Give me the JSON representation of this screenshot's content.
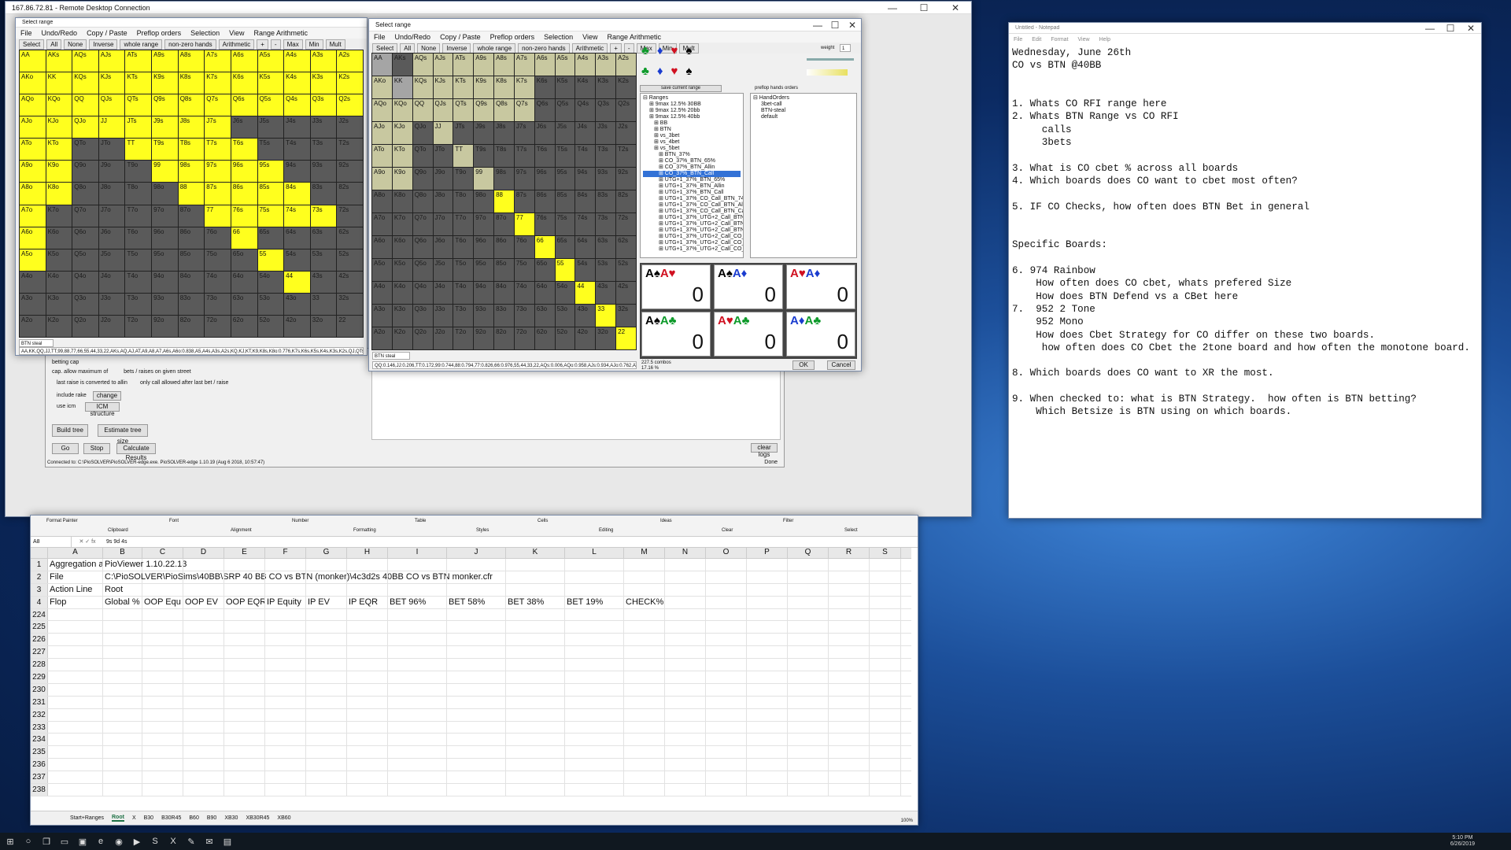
{
  "rdp": {
    "title": "167.86.72.81 - Remote Desktop Connection",
    "min": "—",
    "max": "☐",
    "close": "✕"
  },
  "ranges": [
    "AA",
    "AKs",
    "AQs",
    "AJs",
    "ATs",
    "A9s",
    "A8s",
    "A7s",
    "A6s",
    "A5s",
    "A4s",
    "A3s",
    "A2s",
    "AKo",
    "KK",
    "KQs",
    "KJs",
    "KTs",
    "K9s",
    "K8s",
    "K7s",
    "K6s",
    "K5s",
    "K4s",
    "K3s",
    "K2s",
    "AQo",
    "KQo",
    "QQ",
    "QJs",
    "QTs",
    "Q9s",
    "Q8s",
    "Q7s",
    "Q6s",
    "Q5s",
    "Q4s",
    "Q3s",
    "Q2s",
    "AJo",
    "KJo",
    "QJo",
    "JJ",
    "JTs",
    "J9s",
    "J8s",
    "J7s",
    "J6s",
    "J5s",
    "J4s",
    "J3s",
    "J2s",
    "ATo",
    "KTo",
    "QTo",
    "JTo",
    "TT",
    "T9s",
    "T8s",
    "T7s",
    "T6s",
    "T5s",
    "T4s",
    "T3s",
    "T2s",
    "A9o",
    "K9o",
    "Q9o",
    "J9o",
    "T9o",
    "99",
    "98s",
    "97s",
    "96s",
    "95s",
    "94s",
    "93s",
    "92s",
    "A8o",
    "K8o",
    "Q8o",
    "J8o",
    "T8o",
    "98o",
    "88",
    "87s",
    "86s",
    "85s",
    "84s",
    "83s",
    "82s",
    "A7o",
    "K7o",
    "Q7o",
    "J7o",
    "T7o",
    "97o",
    "87o",
    "77",
    "76s",
    "75s",
    "74s",
    "73s",
    "72s",
    "A6o",
    "K6o",
    "Q6o",
    "J6o",
    "T6o",
    "96o",
    "86o",
    "76o",
    "66",
    "65s",
    "64s",
    "63s",
    "62s",
    "A5o",
    "K5o",
    "Q5o",
    "J5o",
    "T5o",
    "95o",
    "85o",
    "75o",
    "65o",
    "55",
    "54s",
    "53s",
    "52s",
    "A4o",
    "K4o",
    "Q4o",
    "J4o",
    "T4o",
    "94o",
    "84o",
    "74o",
    "64o",
    "54o",
    "44",
    "43s",
    "42s",
    "A3o",
    "K3o",
    "Q3o",
    "J3o",
    "T3o",
    "93o",
    "83o",
    "73o",
    "63o",
    "53o",
    "43o",
    "33",
    "32s",
    "A2o",
    "K2o",
    "Q2o",
    "J2o",
    "T2o",
    "92o",
    "82o",
    "72o",
    "62o",
    "52o",
    "42o",
    "32o",
    "22"
  ],
  "w1": {
    "title": "Select range",
    "menu": [
      "File",
      "Undo/Redo",
      "Copy / Paste",
      "Preflop orders",
      "Selection",
      "View",
      "Range Arithmetic"
    ],
    "tools": [
      "Select",
      "All",
      "None",
      "Inverse",
      "whole range",
      "non-zero hands",
      "Arithmetic",
      "+",
      "-",
      "Max",
      "Min",
      "Mult"
    ],
    "status": "BTN steal",
    "range_text": "AA,KK,QQ,JJ,TT,99,88,77,66,55,44,33,22,AKs,AQ,AJ,AT,A9,A8,A7,A6s,A6o:0.838,A5,A4s,A3s,A2s,KQ,KJ,KT,K9,K8s,K8o:0.776,K7s,K6s,K5s,K4s,K3s,K2s,QJ,QTs,Q9s,Q8s,Q7s,Q6s"
  },
  "w2": {
    "title": "Select range",
    "menu": [
      "File",
      "Undo/Redo",
      "Copy / Paste",
      "Preflop orders",
      "Selection",
      "View",
      "Range Arithmetic"
    ],
    "tools": [
      "Select",
      "All",
      "None",
      "Inverse",
      "whole range",
      "non-zero hands",
      "Arithmetic",
      "+",
      "-",
      "Max",
      "Min",
      "Mult"
    ],
    "weight_label": "weight",
    "weight_value": "1",
    "save_label": "save current range",
    "preflop_label": "preflop hands orders",
    "tree": [
      "Ranges",
      "9max 12.5% 30BB",
      "9max 12.5% 20bb",
      "9max 12.5% 40bb",
      "BB",
      "BTN",
      "vs_3bet",
      "vs_4bet",
      "vs_5bet",
      "BTN_37%",
      "CO_37%_BTN_65%",
      "CO_37%_BTN_Allin",
      "CO_37%_BTN_Call",
      "UTG+1_37%_BTN_65%",
      "UTG+1_37%_BTN_Allin",
      "UTG+1_37%_BTN_Call",
      "UTG+1_37%_CO_Call_BTN_74%",
      "UTG+1_37%_CO_Call_BTN_Allin",
      "UTG+1_37%_CO_Call_BTN_Call",
      "UTG+1_37%_UTG+2_Call_BTN_74",
      "UTG+1_37%_UTG+2_Call_BTN_All",
      "UTG+1_37%_UTG+2_Call_BTN_Ca",
      "UTG+1_37%_UTG+2_Call_CO_Call",
      "UTG+1_37%_UTG+2_Call_CO_Call",
      "UTG+1_37%_UTG+2_Call_CO_Call"
    ],
    "tree_selected": "CO_37%_BTN_Call",
    "hand_orders": [
      "HandOrders",
      "3bet-call",
      "BTN-steal",
      "default"
    ],
    "combos": [
      {
        "a": "A♠",
        "b": "A♥",
        "ca": "blk",
        "cb": "red",
        "v": "0"
      },
      {
        "a": "A♠",
        "b": "A♦",
        "ca": "blk",
        "cb": "blu",
        "v": "0"
      },
      {
        "a": "A♥",
        "b": "A♦",
        "ca": "red",
        "cb": "blu",
        "v": "0"
      },
      {
        "a": "A♠",
        "b": "A♣",
        "ca": "blk",
        "cb": "grn",
        "v": "0"
      },
      {
        "a": "A♥",
        "b": "A♣",
        "ca": "red",
        "cb": "grn",
        "v": "0"
      },
      {
        "a": "A♦",
        "b": "A♣",
        "ca": "blu",
        "cb": "grn",
        "v": "0"
      }
    ],
    "combo_count": "227.5 combos",
    "combo_pct": "17.16 %",
    "ok": "OK",
    "cancel": "Cancel",
    "status": "BTN steal",
    "range_text": "QQ:0.146,JJ:0.206,TT:0.172,99:0.744,88:0.794,77:0.826,66:0.976,55,44,33,22,AQs:0.006,AQo:0.958,AJs:0.934,AJo:0.762,ATs:0.51,ATo:0.51"
  },
  "solver": {
    "betting_cap": "betting cap",
    "cap_label": "cap. allow maximum of",
    "cap_suffix": "bets / raises on given street",
    "last_raise": "last raise is converted to allin",
    "only_call": "only call allowed after last bet / raise",
    "include_rake": "include rake",
    "change": "change",
    "use_icm": "use icm",
    "icm_structure": "ICM structure",
    "build_tree": "Build tree",
    "estimate": "Estimate tree size",
    "go": "Go",
    "stop": "Stop",
    "calc": "Calculate Results",
    "clear_logs": "clear logs",
    "done": "Done",
    "connected": "Connected to: C:\\PioSOLVER\\PioSOLVER-edge.exe. PioSOLVER-edge 1.10.19 (Aug 6 2018, 10:57:47)"
  },
  "notepad": {
    "title": "Untitled - Notepad",
    "menu": [
      "File",
      "Edit",
      "Format",
      "View",
      "Help"
    ],
    "text": "Wednesday, June 26th\nCO vs BTN @40BB\n\n\n1. Whats CO RFI range here\n2. Whats BTN Range vs CO RFI\n     calls\n     3bets\n\n3. What is CO cbet % across all boards\n4. Which boards does CO want to cbet most often?\n\n5. IF CO Checks, how often does BTN Bet in general\n\n\nSpecific Boards:\n\n6. 974 Rainbow\n    How often does CO cbet, whats prefered Size\n    How does BTN Defend vs a CBet here\n7.  952 2 Tone\n    952 Mono\n    How does Cbet Strategy for CO differ on these two boards.\n     how often does CO Cbet the 2tone board and how often the monotone board.\n\n8. Which boards does CO want to XR the most.\n\n9. When checked to: what is BTN Strategy.  how often is BTN betting?\n    Which Betsize is BTN using on which boards."
  },
  "excel": {
    "ribbon": [
      "Format Painter",
      "Clipboard",
      "Font",
      "Alignment",
      "Number",
      "Formatting",
      "Table",
      "Styles",
      "Cells",
      "Editing",
      "Ideas",
      "Clear",
      "Filter",
      "Select"
    ],
    "namebox": "A8",
    "formula": "9s 9d 4s",
    "cols": [
      "A",
      "B",
      "C",
      "D",
      "E",
      "F",
      "G",
      "H",
      "I",
      "J",
      "K",
      "L",
      "M",
      "N",
      "O",
      "P",
      "Q",
      "R",
      "S"
    ],
    "rows": [
      {
        "n": "1",
        "c": [
          "Aggregation an",
          "PioViewer 1.10.22.13"
        ]
      },
      {
        "n": "2",
        "c": [
          "File",
          "C:\\PioSOLVER\\PioSims\\40BB\\SRP 40 BB CO vs BTN (monker)\\4c3d2s 40BB CO vs BTN  monker.cfr"
        ]
      },
      {
        "n": "3",
        "c": [
          "Action Line",
          "Root"
        ]
      },
      {
        "n": "4",
        "c": [
          "Flop",
          "Global %",
          "OOP Equ",
          "OOP EV",
          "OOP EQR",
          "IP Equity",
          "IP EV",
          "IP EQR",
          "BET 96%",
          "BET 58%",
          "BET 38%",
          "BET 19%",
          "CHECK%"
        ]
      },
      {
        "n": "224",
        "c": []
      },
      {
        "n": "225",
        "c": []
      },
      {
        "n": "226",
        "c": []
      },
      {
        "n": "227",
        "c": []
      },
      {
        "n": "228",
        "c": []
      },
      {
        "n": "229",
        "c": []
      },
      {
        "n": "230",
        "c": []
      },
      {
        "n": "231",
        "c": []
      },
      {
        "n": "232",
        "c": []
      },
      {
        "n": "233",
        "c": []
      },
      {
        "n": "234",
        "c": []
      },
      {
        "n": "235",
        "c": []
      },
      {
        "n": "236",
        "c": []
      },
      {
        "n": "237",
        "c": []
      },
      {
        "n": "238",
        "c": []
      }
    ],
    "sheets": [
      "Start+Ranges",
      "Root",
      "X",
      "B30",
      "B30R45",
      "B60",
      "B90",
      "XB30",
      "XB30R45",
      "XB60"
    ],
    "active_sheet": "Root",
    "zoom": "100%"
  },
  "clock": {
    "time": "5:10 PM",
    "date": "6/26/2019"
  },
  "taskbar_icons": [
    "windows-icon",
    "search-icon",
    "task-view-icon",
    "file-explorer-icon",
    "store-icon",
    "edge-icon",
    "chrome-icon",
    "media-icon",
    "skype-icon",
    "excel-icon",
    "notepad-icon",
    "mail-icon",
    "remote-desktop-icon"
  ]
}
